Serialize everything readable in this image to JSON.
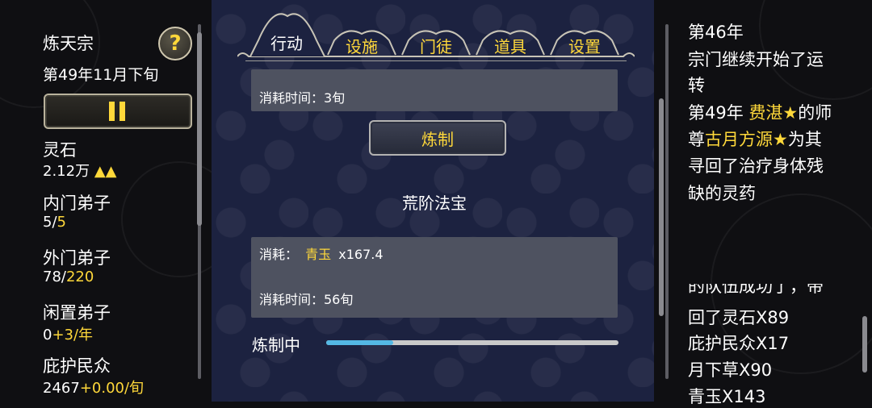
{
  "left": {
    "sect_name": "炼天宗",
    "date": "第49年11月下旬",
    "help_glyph": "?",
    "stats": [
      {
        "title": "灵石",
        "value": "2.12万",
        "extra": "▲▲",
        "extra_color": "#ffd83a"
      },
      {
        "title": "内门弟子",
        "value": "5/",
        "extra": "5"
      },
      {
        "title": "外门弟子",
        "value": "78/",
        "extra": "220"
      },
      {
        "title": "闲置弟子",
        "value": "0",
        "extra": "+3/年"
      },
      {
        "title": "庇护民众",
        "value": "2467",
        "extra": "+0.00/旬"
      }
    ]
  },
  "tabs": [
    {
      "label": "行动",
      "active": true
    },
    {
      "label": "设施",
      "active": false
    },
    {
      "label": "门徒",
      "active": false
    },
    {
      "label": "道具",
      "active": false
    },
    {
      "label": "设置",
      "active": false
    }
  ],
  "center": {
    "top_box_time": "消耗时间：3旬",
    "craft_button": "炼制",
    "item_name": "荒阶法宝",
    "cost_label": "消耗：",
    "cost_item": "青玉",
    "cost_amount": "x167.4",
    "cost_time": "消耗时间：56旬",
    "progress_label": "炼制中",
    "progress_fraction": 0.23
  },
  "log": {
    "line1": "第46年",
    "line2": "宗门继续开始了运",
    "line3": "转",
    "line4_a": "第49年 ",
    "line4_b": "费湛★",
    "line4_c": "的师",
    "line5_a": "尊",
    "line5_b": "古月方源★",
    "line5_c": "为其",
    "line6": "寻回了治疗身体残",
    "line7": "缺的灵药",
    "line8": "的队伍成功了，带",
    "line9": "回了灵石X89",
    "line10": "庇护民众X17",
    "line11": "月下草X90",
    "line12": "青玉X143"
  },
  "colors": {
    "accent": "#ffd83a",
    "progress": "#54b8e4",
    "panel": "#1c2240"
  }
}
